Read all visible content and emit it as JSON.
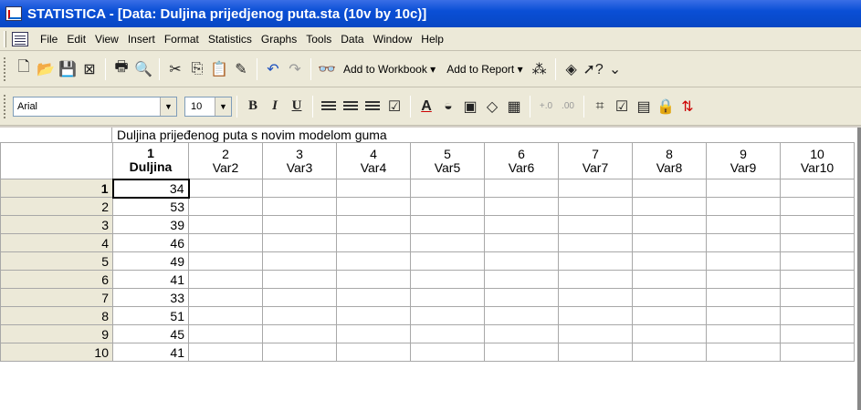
{
  "window": {
    "title": "STATISTICA - [Data: Duljina prijedjenog puta.sta (10v by 10c)]"
  },
  "menu": {
    "items": [
      "File",
      "Edit",
      "View",
      "Insert",
      "Format",
      "Statistics",
      "Graphs",
      "Tools",
      "Data",
      "Window",
      "Help"
    ]
  },
  "toolbar1": {
    "add_to_workbook": "Add to Workbook ▾",
    "add_to_report": "Add to Report ▾"
  },
  "toolbar2": {
    "font": "Arial",
    "size": "10"
  },
  "sheet": {
    "title": "Duljina prijeđenog puta s novim modelom guma",
    "columns": [
      {
        "num": "1",
        "name": "Duljina"
      },
      {
        "num": "2",
        "name": "Var2"
      },
      {
        "num": "3",
        "name": "Var3"
      },
      {
        "num": "4",
        "name": "Var4"
      },
      {
        "num": "5",
        "name": "Var5"
      },
      {
        "num": "6",
        "name": "Var6"
      },
      {
        "num": "7",
        "name": "Var7"
      },
      {
        "num": "8",
        "name": "Var8"
      },
      {
        "num": "9",
        "name": "Var9"
      },
      {
        "num": "10",
        "name": "Var10"
      }
    ],
    "rows": [
      {
        "num": "1",
        "value": "34"
      },
      {
        "num": "2",
        "value": "53"
      },
      {
        "num": "3",
        "value": "39"
      },
      {
        "num": "4",
        "value": "46"
      },
      {
        "num": "5",
        "value": "49"
      },
      {
        "num": "6",
        "value": "41"
      },
      {
        "num": "7",
        "value": "33"
      },
      {
        "num": "8",
        "value": "51"
      },
      {
        "num": "9",
        "value": "45"
      },
      {
        "num": "10",
        "value": "41"
      }
    ]
  }
}
